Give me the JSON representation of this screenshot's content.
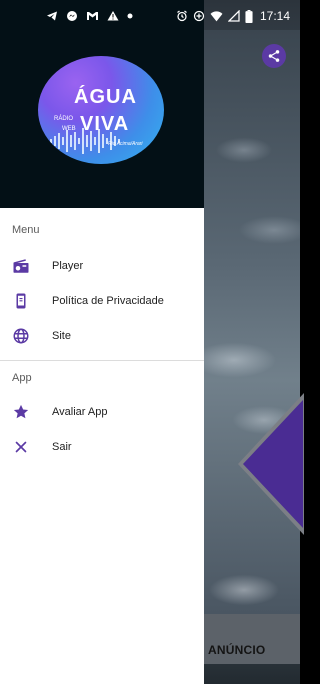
{
  "status_bar": {
    "time": "17:14",
    "icons_left": [
      "telegram-icon",
      "messenger-icon",
      "gmail-icon",
      "warning-icon",
      "dot-icon"
    ],
    "icons_right": [
      "alarm-icon",
      "data-saver-icon",
      "wifi-icon",
      "signal-icon",
      "battery-icon"
    ]
  },
  "drawer": {
    "logo": {
      "line1": "ÁGUA",
      "line2": "VIVA",
      "radio": "RÁDIO",
      "web": "WEB",
      "sub": "Rio Acima/Arari"
    },
    "menu_title": "Menu",
    "menu_items": [
      {
        "label": "Player",
        "icon": "radio-icon"
      },
      {
        "label": "Política de Privacidade",
        "icon": "phone-icon"
      },
      {
        "label": "Site",
        "icon": "globe-icon"
      }
    ],
    "app_title": "App",
    "app_items": [
      {
        "label": "Avaliar App",
        "icon": "star-icon"
      },
      {
        "label": "Sair",
        "icon": "close-icon"
      }
    ]
  },
  "background": {
    "ad_label": "ANÚNCIO"
  },
  "colors": {
    "accent": "#5b3aa4",
    "drawer_header": "#031016"
  }
}
